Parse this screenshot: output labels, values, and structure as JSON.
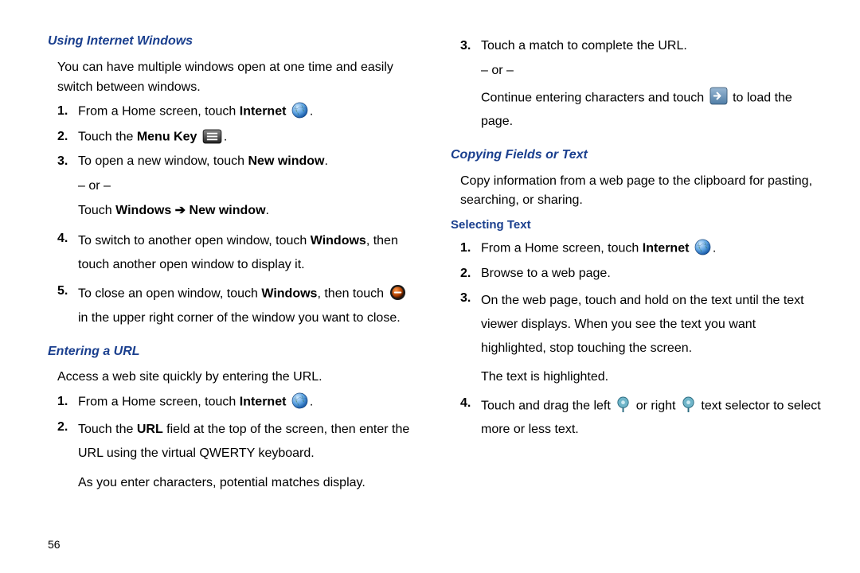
{
  "pageNumber": "56",
  "left": {
    "section1": {
      "title": "Using Internet Windows",
      "intro": "You can have multiple windows open at one time and easily switch between windows.",
      "steps": {
        "s1_num": "1.",
        "s1_a": "From a Home screen, touch ",
        "s1_b": "Internet",
        "s1_c": ".",
        "s2_num": "2.",
        "s2_a": "Touch the ",
        "s2_b": "Menu Key",
        "s2_c": ".",
        "s3_num": "3.",
        "s3_a": "To open a new window, touch ",
        "s3_b": "New window",
        "s3_c": ".",
        "s3_or": "– or –",
        "s3_alt_a": "Touch ",
        "s3_alt_b": "Windows",
        "s3_alt_arrow": " ➔ ",
        "s3_alt_c": "New window",
        "s3_alt_d": ".",
        "s4_num": "4.",
        "s4_a": "To switch to another open window, touch ",
        "s4_b": "Windows",
        "s4_c": ", then touch another open window to display it.",
        "s5_num": "5.",
        "s5_a": "To close an open window, touch ",
        "s5_b": "Windows",
        "s5_c": ", then touch ",
        "s5_d": "in the upper right corner of the window you want to close."
      }
    },
    "section2": {
      "title": "Entering a URL",
      "intro": "Access a web site quickly by entering the URL.",
      "steps": {
        "s1_num": "1.",
        "s1_a": "From a Home screen, touch ",
        "s1_b": "Internet",
        "s1_c": ".",
        "s2_num": "2.",
        "s2_a": "Touch the ",
        "s2_b": "URL",
        "s2_c": " field at the top of the screen, then enter the URL using the virtual QWERTY keyboard.",
        "s2_sub": "As you enter characters, potential matches display."
      }
    }
  },
  "right": {
    "cont": {
      "s3_num": "3.",
      "s3_a": "Touch a match to complete the URL.",
      "s3_or": "– or –",
      "s3_alt_a": "Continue entering characters and touch ",
      "s3_alt_b": " to load the page."
    },
    "section3": {
      "title": "Copying Fields or Text",
      "intro": "Copy information from a web page to the clipboard for pasting, searching, or sharing."
    },
    "sub1": {
      "title": "Selecting Text",
      "steps": {
        "s1_num": "1.",
        "s1_a": "From a Home screen, touch ",
        "s1_b": "Internet",
        "s1_c": ".",
        "s2_num": "2.",
        "s2_a": "Browse to a web page.",
        "s3_num": "3.",
        "s3_a": "On the web page, touch and hold on the text until the text viewer displays. When you see the text you want highlighted, stop touching the screen.",
        "s3_sub": "The text is highlighted.",
        "s4_num": "4.",
        "s4_a": "Touch and drag the left ",
        "s4_b": " or right ",
        "s4_c": " text selector to select more or less text."
      }
    }
  }
}
